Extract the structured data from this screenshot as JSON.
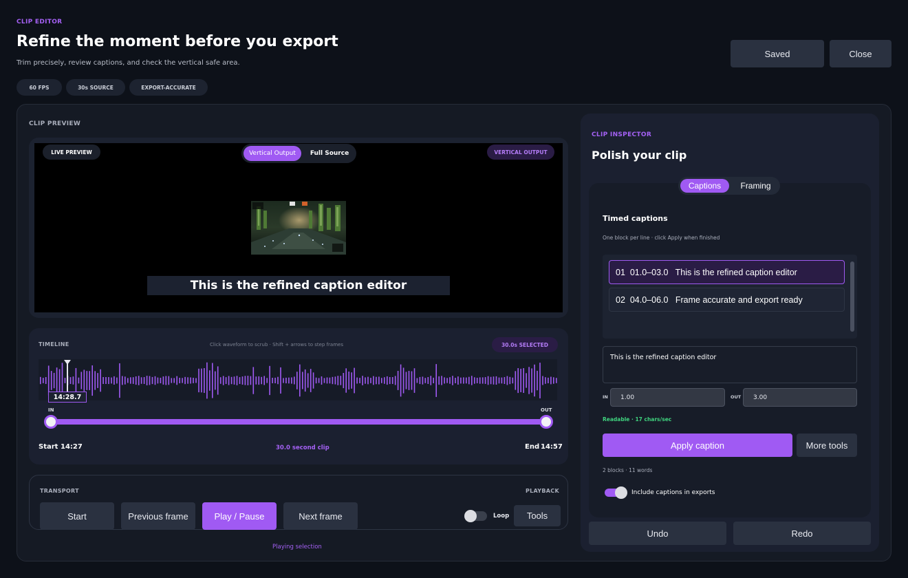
{
  "header": {
    "eyebrow": "CLIP EDITOR",
    "title": "Refine the moment before you export",
    "subtitle": "Trim precisely, review captions, and check the vertical safe area.",
    "chips": [
      "60 FPS",
      "30s SOURCE",
      "EXPORT-ACCURATE"
    ],
    "saved_label": "Saved",
    "close_label": "Close"
  },
  "preview": {
    "section_label": "CLIP PREVIEW",
    "live_badge": "LIVE PREVIEW",
    "toggle": {
      "options": [
        "Vertical Output",
        "Full Source"
      ],
      "selected": "Vertical Output"
    },
    "output_badge": "VERTICAL OUTPUT",
    "caption_text": "This is the refined caption editor"
  },
  "timeline": {
    "label": "TIMELINE",
    "hint": "Click waveform to scrub · Shift + arrows to step frames",
    "selected_badge": "30.0s SELECTED",
    "playhead_time": "14:28.7",
    "in_label": "IN",
    "out_label": "OUT",
    "start_label": "Start",
    "start_time": "14:27",
    "clip_length": "30.0 second clip",
    "end_label": "End",
    "end_time": "14:57"
  },
  "transport": {
    "label": "TRANSPORT",
    "playback_label": "PLAYBACK",
    "buttons": [
      "Start",
      "Previous frame",
      "Play / Pause",
      "Next frame"
    ],
    "loop_label": "Loop",
    "loop_on": false,
    "tools_label": "Tools",
    "status": "Playing selection"
  },
  "inspector": {
    "eyebrow": "CLIP INSPECTOR",
    "title": "Polish your clip",
    "tabs": [
      "Captions",
      "Framing"
    ],
    "active_tab": "Captions",
    "section_title": "Timed captions",
    "section_hint": "One block per line · click Apply when finished",
    "captions": [
      {
        "index": "01",
        "range": "01.0–03.0",
        "text": "This is the refined caption editor"
      },
      {
        "index": "02",
        "range": "04.0–06.0",
        "text": "Frame accurate and export ready"
      }
    ],
    "caption_rows": [
      "01  01.0–03.0   This is the refined caption editor",
      "02  04.0–06.0   Frame accurate and export ready"
    ],
    "editor_text": "This is the refined caption editor",
    "in_label": "IN",
    "in_value": "1.00",
    "out_label": "OUT",
    "out_value": "3.00",
    "readability": "Readable · 17 chars/sec",
    "apply_label": "Apply caption",
    "more_tools_label": "More tools",
    "stats": "2 blocks · 11 words",
    "include_label": "Include captions in exports",
    "include_on": true,
    "undo_label": "Undo",
    "redo_label": "Redo"
  },
  "colors": {
    "accent": "#a05af3",
    "background": "#0d1119",
    "panel": "#161b26",
    "ready_green": "#3fd27e"
  }
}
